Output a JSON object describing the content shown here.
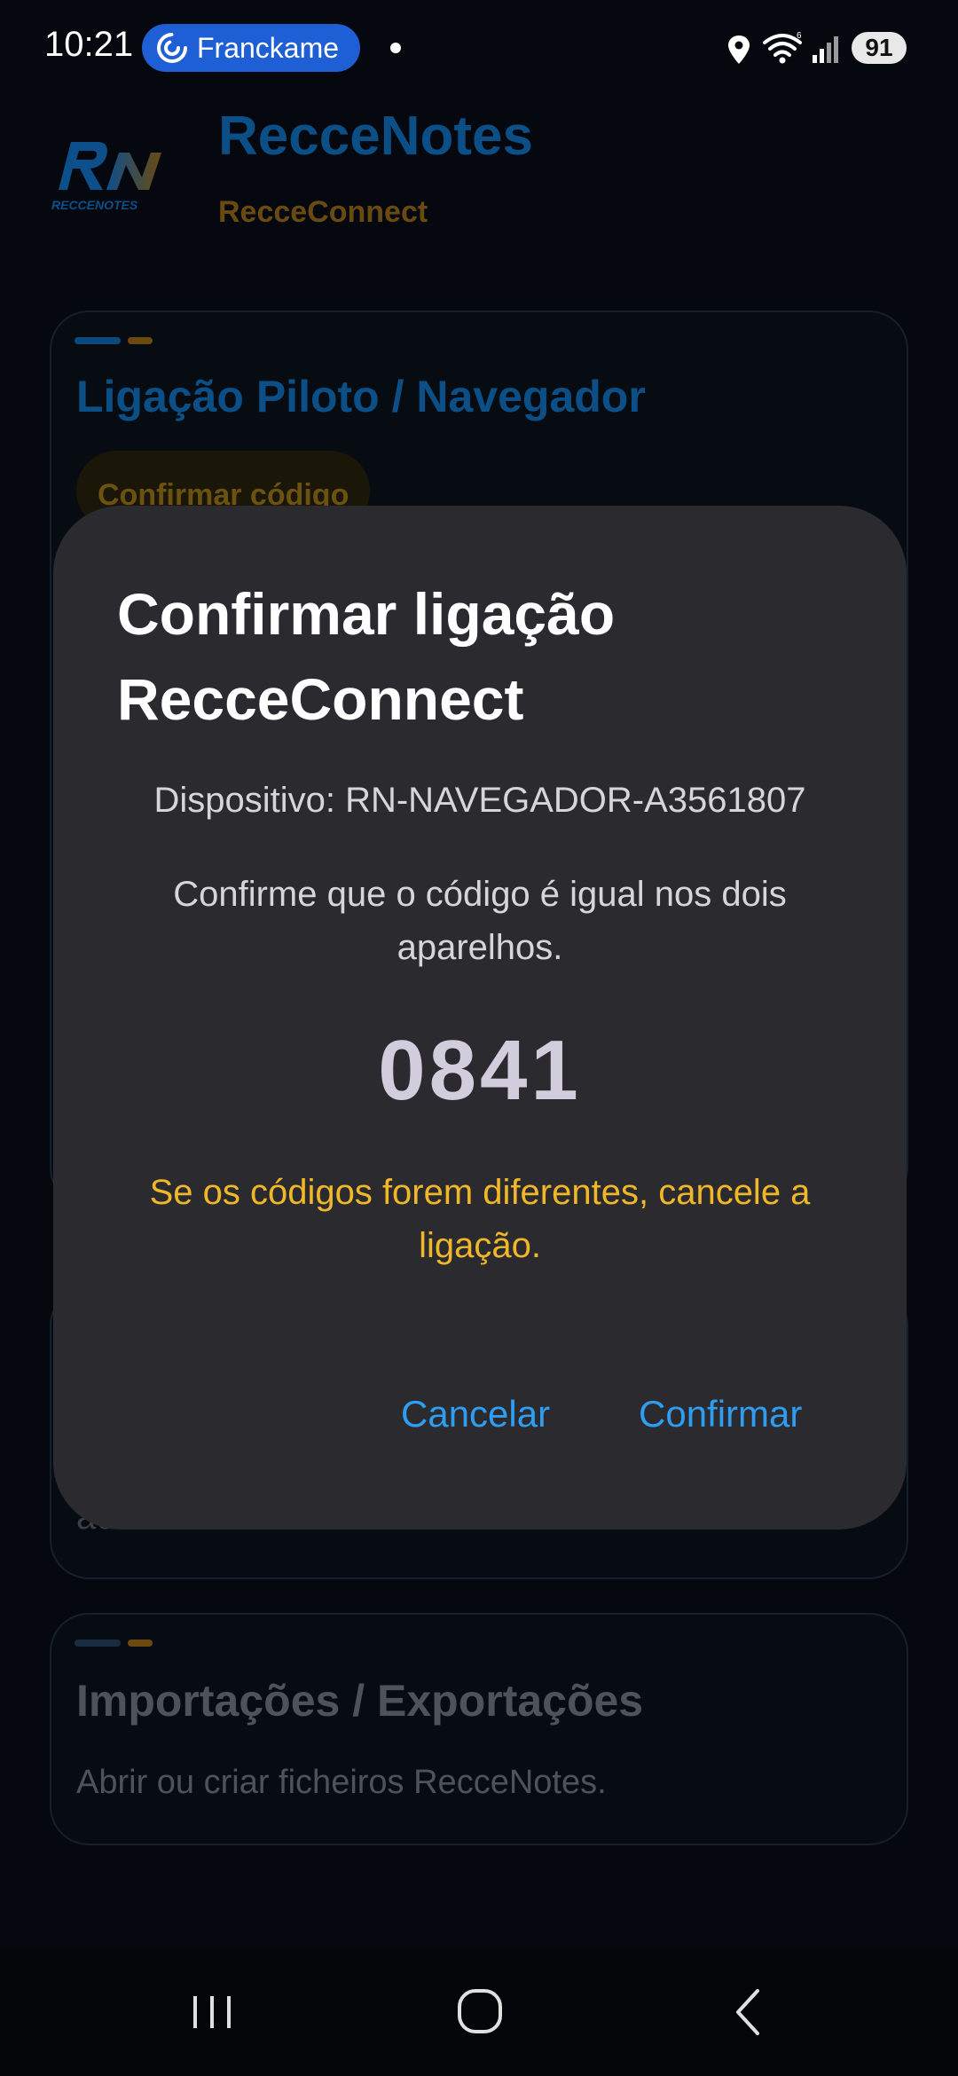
{
  "status_bar": {
    "time": "10:21",
    "chip_label": "Franckame",
    "battery": "91"
  },
  "app": {
    "title": "RecceNotes",
    "subtitle": "RecceConnect",
    "logo_text": "RECCENOTES"
  },
  "cards": {
    "pairing": {
      "title": "Ligação Piloto / Navegador",
      "button": "Confirmar código"
    },
    "second": {
      "partial_text": "ac"
    },
    "imports": {
      "title": "Importações / Exportações",
      "description": "Abrir ou criar ficheiros RecceNotes."
    }
  },
  "dialog": {
    "title": "Confirmar ligação RecceConnect",
    "device": "Dispositivo: RN-NAVEGADOR-A3561807",
    "message": "Confirme que o código é igual nos dois aparelhos.",
    "code": "0841",
    "warning": "Se os códigos forem diferentes, cancele a ligação.",
    "cancel_label": "Cancelar",
    "confirm_label": "Confirmar"
  },
  "nav_bar": {
    "icons": [
      "recent-apps-icon",
      "home-icon",
      "back-icon"
    ]
  },
  "colors": {
    "accent_blue": "#2f9ef2",
    "warning_yellow": "#f0b828",
    "dialog_bg": "#2b2a2f",
    "brand_blue": "#0c4f86",
    "brand_gold": "#6b4a12"
  }
}
